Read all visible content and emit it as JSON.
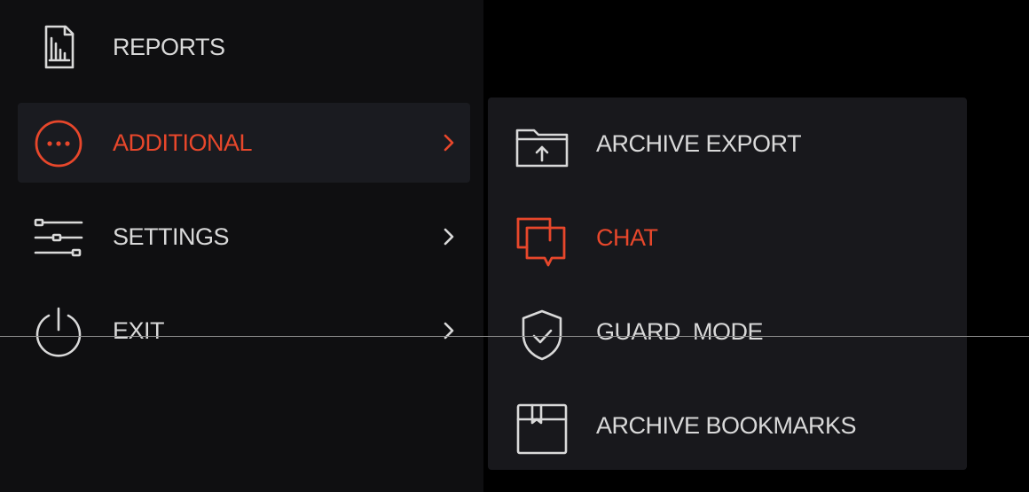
{
  "colors": {
    "background": "#000000",
    "menu_bg": "#0f0f11",
    "active_item_bg": "#1a1b20",
    "submenu_bg": "#18181c",
    "text": "#d9d9d9",
    "accent": "#e8472b",
    "icon_stroke": "#d9d9d9"
  },
  "main_menu": {
    "items": [
      {
        "label": "REPORTS",
        "icon": "report-document-icon",
        "has_submenu": false,
        "active": false
      },
      {
        "label": "ADDITIONAL",
        "icon": "more-dots-circle-icon",
        "has_submenu": true,
        "active": true
      },
      {
        "label": "SETTINGS",
        "icon": "sliders-icon",
        "has_submenu": true,
        "active": false
      },
      {
        "label": "EXIT",
        "icon": "power-icon",
        "has_submenu": true,
        "active": false
      }
    ]
  },
  "submenu": {
    "items": [
      {
        "label": "ARCHIVE EXPORT",
        "icon": "folder-upload-icon",
        "active": false
      },
      {
        "label": "CHAT",
        "icon": "chat-bubbles-icon",
        "active": true
      },
      {
        "label": "GUARD  MODE",
        "icon": "shield-check-icon",
        "active": false
      },
      {
        "label": "ARCHIVE BOOKMARKS",
        "icon": "bookmark-book-icon",
        "active": false
      }
    ]
  }
}
